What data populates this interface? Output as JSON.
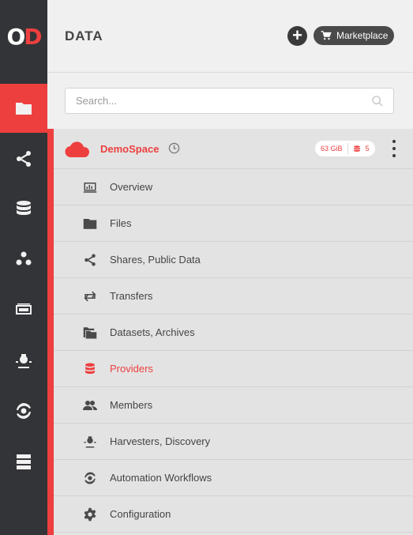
{
  "app": {
    "logo_text": "OD"
  },
  "rail": {
    "items": [
      {
        "icon": "folder-icon",
        "active": true
      },
      {
        "icon": "share-icon",
        "active": false
      },
      {
        "icon": "database-icon",
        "active": false
      },
      {
        "icon": "groups-icon",
        "active": false
      },
      {
        "icon": "tokens-icon",
        "active": false
      },
      {
        "icon": "harvester-icon",
        "active": false
      },
      {
        "icon": "automation-icon",
        "active": false
      },
      {
        "icon": "clusters-icon",
        "active": false
      }
    ]
  },
  "header": {
    "title": "DATA",
    "marketplace_label": "Marketplace"
  },
  "search": {
    "placeholder": "Search..."
  },
  "space": {
    "name": "DemoSpace",
    "size": "63 GiB",
    "providers_count": "5",
    "accent_color": "#ee3f3f"
  },
  "menu": {
    "items": [
      {
        "label": "Overview",
        "icon": "overview-icon"
      },
      {
        "label": "Files",
        "icon": "folder-icon"
      },
      {
        "label": "Shares, Public Data",
        "icon": "share-icon"
      },
      {
        "label": "Transfers",
        "icon": "transfers-icon"
      },
      {
        "label": "Datasets, Archives",
        "icon": "datasets-icon"
      },
      {
        "label": "Providers",
        "icon": "database-icon",
        "active": true
      },
      {
        "label": "Members",
        "icon": "members-icon"
      },
      {
        "label": "Harvesters, Discovery",
        "icon": "harvester-icon"
      },
      {
        "label": "Automation Workflows",
        "icon": "automation-icon"
      },
      {
        "label": "Configuration",
        "icon": "gear-icon"
      }
    ]
  }
}
